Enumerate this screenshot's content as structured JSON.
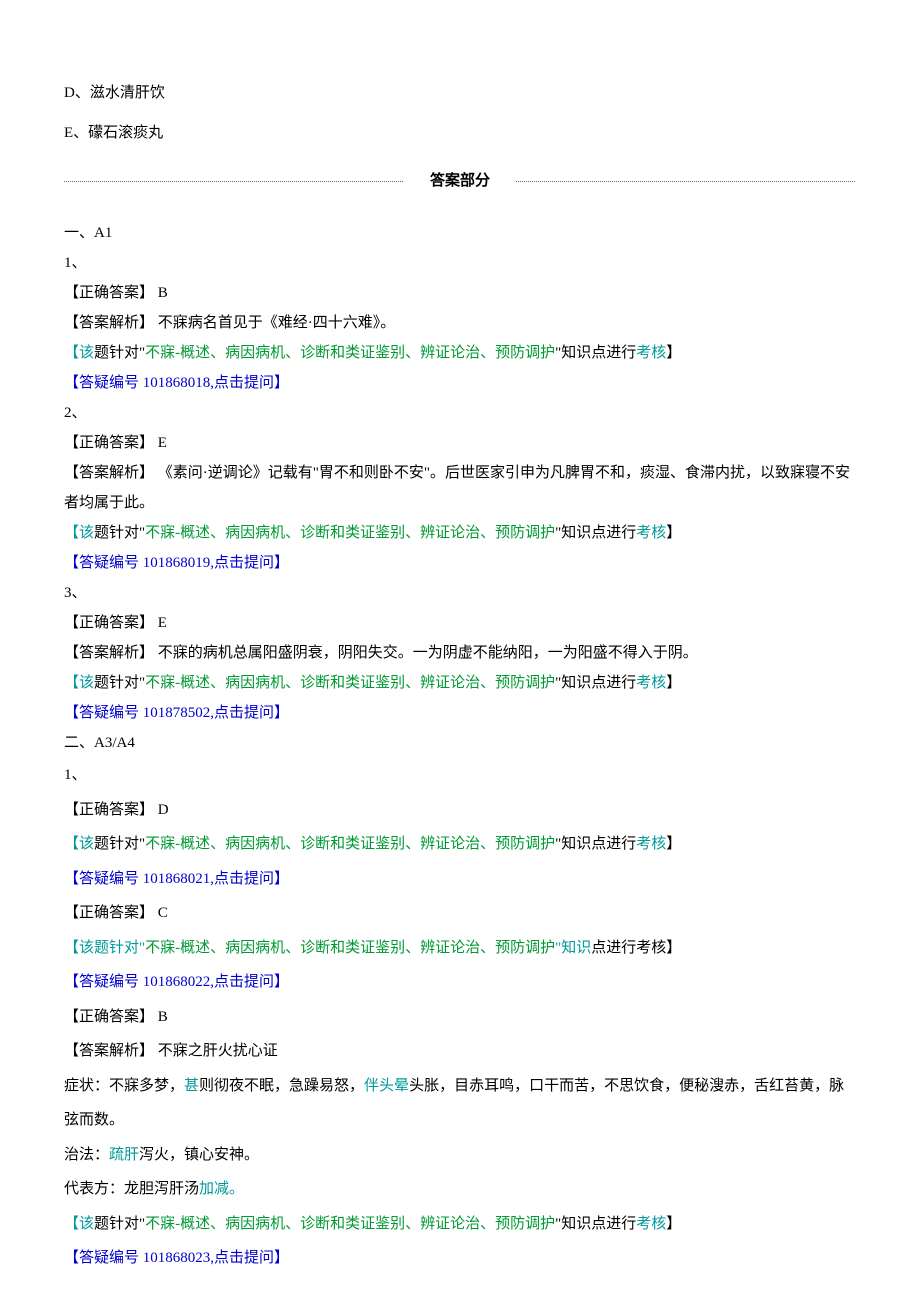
{
  "options": {
    "d": "D、滋水清肝饮",
    "e": "E、礞石滚痰丸"
  },
  "section_title": "答案部分",
  "cat1": "一、A1",
  "q1": {
    "num": "1、",
    "correct": "【正确答案】 B",
    "explain": "【答案解析】 不寐病名首见于《难经·四十六难》。",
    "note_p1": "【该",
    "note_p2": "题针对\"",
    "note_p3": "不寐-概述、病因病机、诊断和类证鉴别、辨证论治、预防调护",
    "note_p4": "\"知识点进行",
    "note_p5": "考核",
    "note_p6": "】",
    "link": "【答疑编号 101868018,点击提问】"
  },
  "q2": {
    "num": "2、",
    "correct": "【正确答案】 E",
    "explain": "【答案解析】 《素问·逆调论》记载有\"胃不和则卧不安\"。后世医家引申为凡脾胃不和，痰湿、食滞内扰，以致寐寝不安者均属于此。",
    "note_p1": "【该",
    "note_p2": "题针对\"",
    "note_p3": "不寐-概述、病因病机、诊断和类证鉴别、辨证论治、预防调护",
    "note_p4": "\"知识点进行",
    "note_p5": "考核",
    "note_p6": "】",
    "link": "【答疑编号 101868019,点击提问】"
  },
  "q3": {
    "num": "3、",
    "correct": "【正确答案】 E",
    "explain": "【答案解析】 不寐的病机总属阳盛阴衰，阴阳失交。一为阴虚不能纳阳，一为阳盛不得入于阴。",
    "note_p1": "【该",
    "note_p2": "题针对\"",
    "note_p3": "不寐-概述、病因病机、诊断和类证鉴别、辨证论治、预防调护",
    "note_p4": "\"知识点进行",
    "note_p5": "考核",
    "note_p6": "】",
    "link": "【答疑编号 101878502,点击提问】"
  },
  "cat2": "二、A3/A4",
  "a34": {
    "num": "1、",
    "a1_correct": "【正确答案】 D",
    "a1_note_p1": "【该",
    "a1_note_p2": "题针对\"",
    "a1_note_p3": "不寐-概述、病因病机、诊断和类证鉴别、辨证论治、预防调护",
    "a1_note_p4": "\"知识点进行",
    "a1_note_p5": "考核",
    "a1_note_p6": "】",
    "a1_link": "【答疑编号 101868021,点击提问】",
    "a2_correct": "【正确答案】 C",
    "a2_note_p1": "【该题针对\"",
    "a2_note_p2": "不寐-概述、病因病机、诊断和类证鉴别、辨证论治、预防调护",
    "a2_note_p3": "\"知识",
    "a2_note_p4": "点进行考核】",
    "a2_link": "【答疑编号 101868022,点击提问】",
    "a3_correct": "【正确答案】 B",
    "a3_explain": "【答案解析】 不寐之肝火扰心证",
    "a3_sym_p1": "症状：不寐多梦，",
    "a3_sym_p2": "甚",
    "a3_sym_p3": "则彻夜不眠，急躁易怒，",
    "a3_sym_p4": "伴头晕",
    "a3_sym_p5": "头胀，目赤耳鸣，口干而苦，不思饮食，便秘溲赤，舌红苔黄，脉弦而数。",
    "a3_zf_p1": "治法：",
    "a3_zf_p2": "疏肝",
    "a3_zf_p3": "泻火，镇心安神。",
    "a3_df_p1": "代表方：龙胆泻肝汤",
    "a3_df_p2": "加减。",
    "a3_note_p1": "【该",
    "a3_note_p2": "题针对\"",
    "a3_note_p3": "不寐-概述、病因病机、诊断和类证鉴别、辨证论治、预防调护",
    "a3_note_p4": "\"知识点进行",
    "a3_note_p5": "考核",
    "a3_note_p6": "】",
    "a3_link": "【答疑编号 101868023,点击提问】"
  }
}
